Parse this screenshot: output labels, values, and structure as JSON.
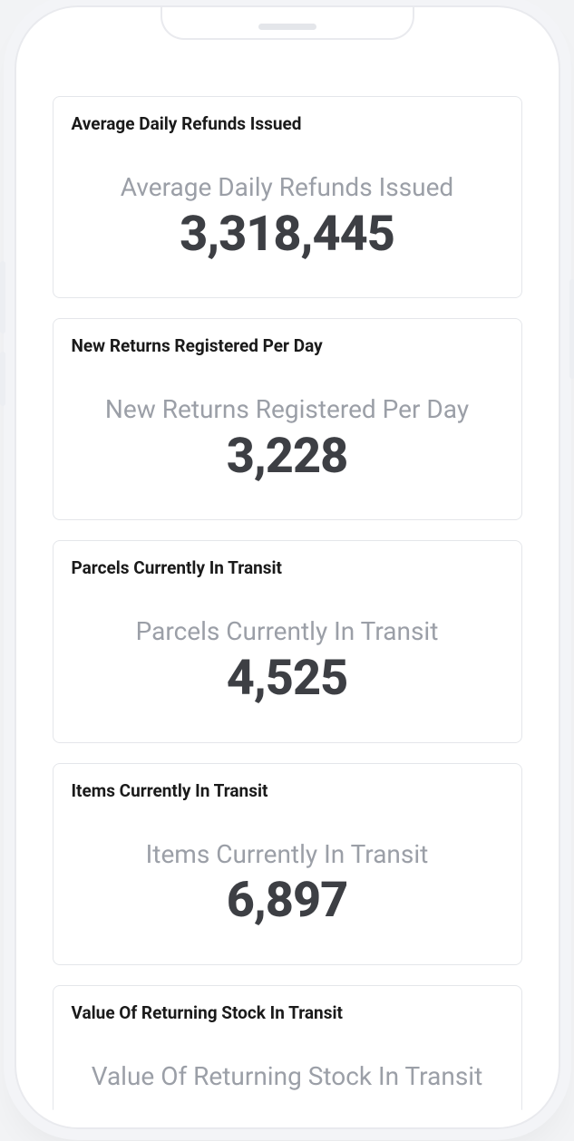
{
  "cards": [
    {
      "header": "Average Daily Refunds Issued",
      "label": "Average Daily Refunds Issued",
      "value": "3,318,445"
    },
    {
      "header": "New Returns Registered Per Day",
      "label": "New Returns Registered Per Day",
      "value": "3,228"
    },
    {
      "header": "Parcels Currently In Transit",
      "label": "Parcels Currently In Transit",
      "value": "4,525"
    },
    {
      "header": "Items Currently In Transit",
      "label": "Items Currently In Transit",
      "value": "6,897"
    },
    {
      "header": "Value Of Returning Stock In Transit",
      "label": "Value Of Returning Stock In Transit",
      "value": ""
    }
  ]
}
